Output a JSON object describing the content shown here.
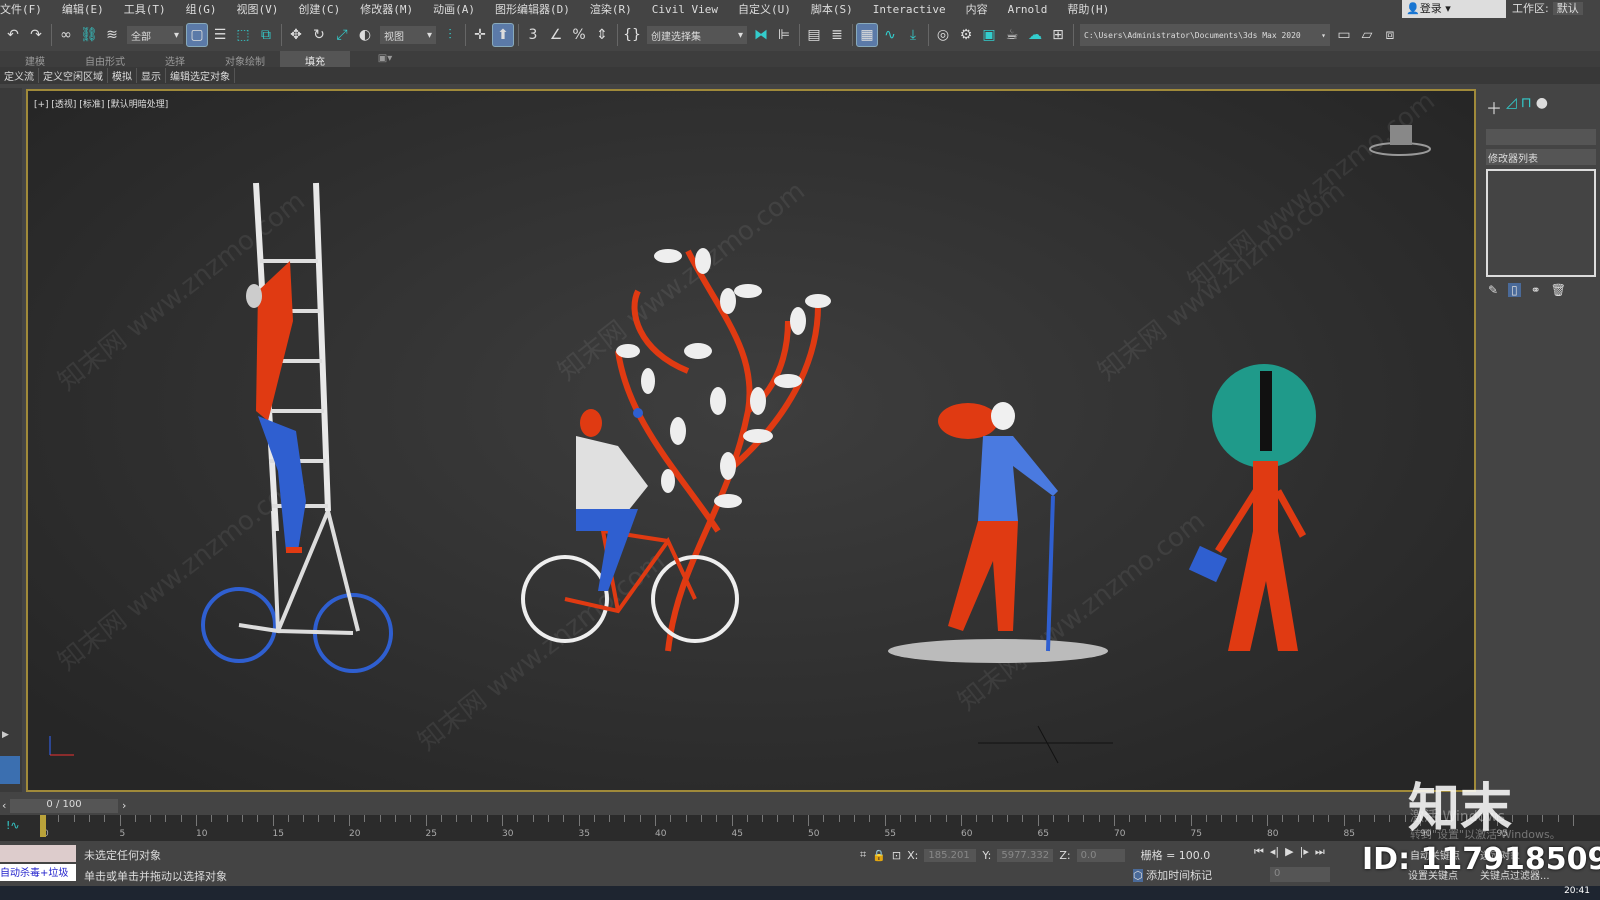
{
  "menu": [
    "文件(F)",
    "编辑(E)",
    "工具(T)",
    "组(G)",
    "视图(V)",
    "创建(C)",
    "修改器(M)",
    "动画(A)",
    "图形编辑器(D)",
    "渲染(R)",
    "Civil View",
    "自定义(U)",
    "脚本(S)",
    "Interactive",
    "内容",
    "Arnold",
    "帮助(H)"
  ],
  "account": {
    "login": "登录",
    "workspace_label": "工作区:",
    "workspace_value": "默认"
  },
  "toolbar": {
    "selection_filter": "全部",
    "ref_coord": "视图",
    "named_selection": "创建选择集",
    "project_path": "C:\\Users\\Administrator\\Documents\\3ds Max 2020"
  },
  "ribbon_tabs": [
    "建模",
    "自由形式",
    "选择",
    "对象绘制",
    "填充"
  ],
  "ribbon_sub": [
    "定义流",
    "定义空闲区域",
    "模拟",
    "显示",
    "编辑选定对象"
  ],
  "viewport": {
    "label": "[+] [透视] [标准] [默认明暗处理]",
    "watermark": "知末网 www.znzmo.com"
  },
  "panel": {
    "modifier_list": "修改器列表"
  },
  "timeline": {
    "frame": "0 / 100",
    "ticks": [
      "0",
      "5",
      "10",
      "15",
      "20",
      "25",
      "30",
      "35",
      "40",
      "45",
      "50",
      "55",
      "60",
      "65",
      "70",
      "75",
      "80",
      "85",
      "90",
      "95"
    ]
  },
  "status": {
    "maxscript": "自动杀毒+垃圾",
    "line1": "未选定任何对象",
    "line2": "单击或单击并拖动以选择对象",
    "x_label": "X:",
    "x": "185.201",
    "y_label": "Y:",
    "y": "5977.332",
    "z_label": "Z:",
    "z": "0.0",
    "grid": "栅格 = 100.0",
    "add_time_tag": "添加时间标记",
    "frame_field": "0",
    "set_key": "设置关键点",
    "key_filter": "关键点过滤器...",
    "auto_key": "自动关键点",
    "selected": "选定对象"
  },
  "overlay": {
    "brand": "知末",
    "id": "ID: 1179185090",
    "activate1": "激活 Windows",
    "activate2": "转到\"设置\"以激活 Windows。"
  },
  "clock": "20:41",
  "colors": {
    "accent_red": "#e03a12",
    "blue": "#2f5fd0",
    "teal": "#1f9a8a",
    "viewport_border": "#a08a3a"
  }
}
